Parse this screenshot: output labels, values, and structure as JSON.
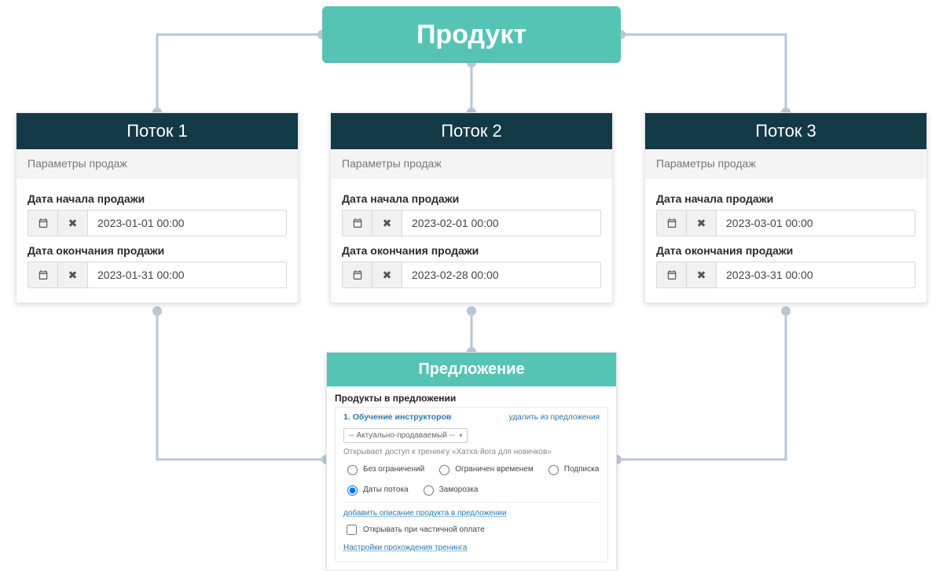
{
  "product": {
    "title": "Продукт"
  },
  "labels": {
    "start_date": "Дата начала продажи",
    "end_date": "Дата окончания продажи"
  },
  "flows": [
    {
      "title": "Поток 1",
      "section": "Параметры продаж",
      "start": "2023-01-01 00:00",
      "end": "2023-01-31 00:00"
    },
    {
      "title": "Поток 2",
      "section": "Параметры продаж",
      "start": "2023-02-01 00:00",
      "end": "2023-02-28 00:00"
    },
    {
      "title": "Поток 3",
      "section": "Параметры продаж",
      "start": "2023-03-01 00:00",
      "end": "2023-03-31 00:00"
    }
  ],
  "offer": {
    "title": "Предложение",
    "section": "Продукты в предложении",
    "product_index": "1. ",
    "product_name": "Обучение инструкторов",
    "remove_label": "удалить из предложения",
    "select_value": "-- Актуально-продаваемый --",
    "hint": "Открывает доступ к тренингу «Хатха-йога для новичков»",
    "radios": [
      "Без ограничений",
      "Ограничен временем",
      "Подписка",
      "Даты потока",
      "Заморозка"
    ],
    "radio_selected_index": 3,
    "add_description": "добавить описание продукта в предложении",
    "partial_payment": "Открывать при частичной оплате",
    "training_settings": "Настройки прохождения тренинга"
  },
  "colors": {
    "accent_teal": "#56c4b5",
    "header_dark": "#133947",
    "connector": "#b9c7d4"
  }
}
